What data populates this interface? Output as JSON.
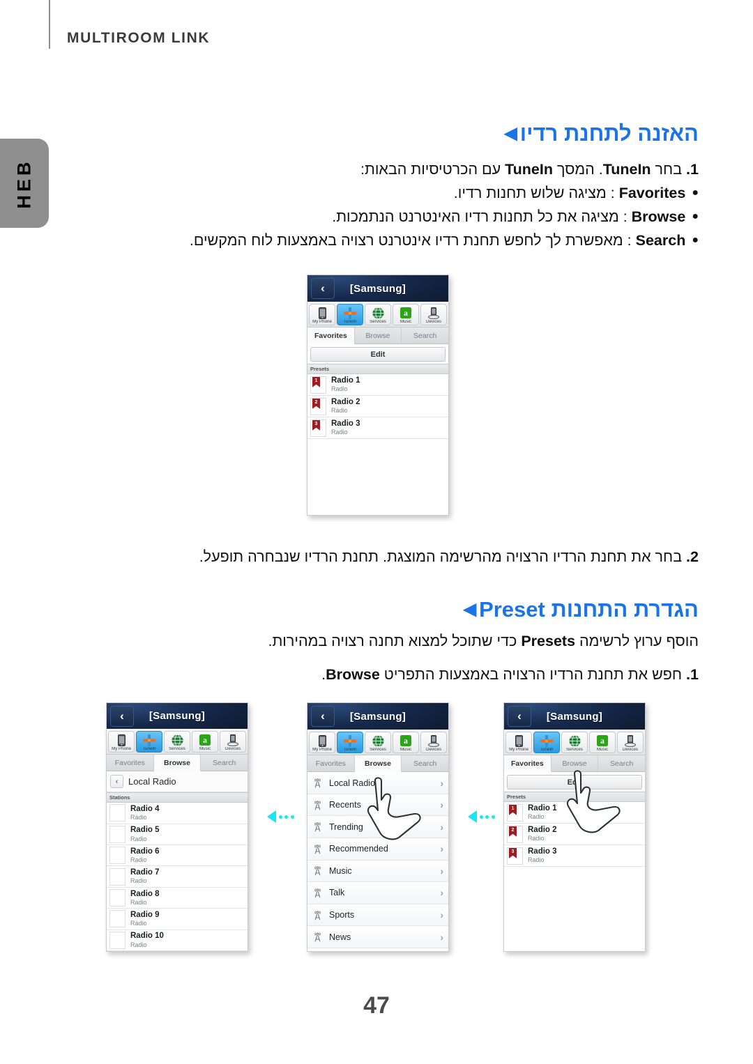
{
  "page": {
    "running_head": "MULTIROOM LINK",
    "language_tab": "HEB",
    "page_number": "47"
  },
  "sections": [
    {
      "id": "listen",
      "heading": "האזנה לתחנת רדיו",
      "marker": "◀",
      "steps": [
        {
          "number": "1.",
          "text_a": "בחר ",
          "bold_a": "TuneIn",
          "text_b": ". המסך ",
          "bold_b": "TuneIn",
          "text_c": " עם הכרטיסיות הבאות:"
        }
      ],
      "bullets": [
        {
          "marker": "●",
          "term": "Favorites",
          "text": " : מציגה שלוש תחנות רדיו."
        },
        {
          "marker": "●",
          "term": "Browse",
          "text": " : מציגה את כל תחנות רדיו האינטרנט הנתמכות."
        },
        {
          "marker": "●",
          "term": "Search",
          "text": " : מאפשרת לך לחפש תחנת רדיו אינטרנט רצויה באמצעות לוח המקשים."
        }
      ],
      "step2": {
        "number": "2.",
        "text": "בחר את תחנת הרדיו הרצויה מהרשימה המוצגת. תחנת הרדיו שנבחרה תופעל."
      }
    },
    {
      "id": "preset",
      "heading_rtl": "הגדרת התחנות ",
      "heading_ltr": "Preset",
      "marker": "◀",
      "lead_a": "הוסף ערוץ לרשימה ",
      "lead_bold": "Presets",
      "lead_b": " כדי שתוכל למצוא תחנה רצויה במהירות.",
      "step1": {
        "number": "1.",
        "text_a": "חפש את תחנת הרדיו הרצויה באמצעות התפריט ",
        "bold": "Browse",
        "text_b": "."
      }
    }
  ],
  "phone_ui": {
    "title": "[Samsung]",
    "back_glyph": "‹",
    "toolbar": [
      {
        "name": "My Phone",
        "icon": "phone-icon",
        "active": false
      },
      {
        "name": "TuneIn",
        "icon": "tunein-icon",
        "active": true
      },
      {
        "name": "Services",
        "icon": "globe-icon",
        "active": false
      },
      {
        "name": "Music",
        "icon": "amazon-music-icon",
        "active": false
      },
      {
        "name": "Devices",
        "icon": "dock-device-icon",
        "active": false
      }
    ],
    "tabs": [
      "Favorites",
      "Browse",
      "Search"
    ],
    "edit_label": "Edit",
    "presets_header": "Presets",
    "stations_header": "Stations",
    "crumb_label": "Local Radio",
    "chevron": "›",
    "sub_label": "Radio"
  },
  "screens": {
    "favorites": {
      "active_tab": "Favorites",
      "list_header": "Presets",
      "items": [
        {
          "preset": "1",
          "name": "Radio 1",
          "sub": "Radio"
        },
        {
          "preset": "2",
          "name": "Radio 2",
          "sub": "Radio"
        },
        {
          "preset": "3",
          "name": "Radio 3",
          "sub": "Radio"
        }
      ]
    },
    "local_radio": {
      "active_tab": "Browse",
      "crumb": "Local Radio",
      "list_header": "Stations",
      "items": [
        {
          "name": "Radio 4",
          "sub": "Radio"
        },
        {
          "name": "Radio 5",
          "sub": "Radio"
        },
        {
          "name": "Radio 6",
          "sub": "Radio"
        },
        {
          "name": "Radio 7",
          "sub": "Radio"
        },
        {
          "name": "Radio 8",
          "sub": "Radio"
        },
        {
          "name": "Radio 9",
          "sub": "Radio"
        },
        {
          "name": "Radio 10",
          "sub": "Radio"
        }
      ]
    },
    "browse": {
      "active_tab": "Browse",
      "items": [
        {
          "name": "Local Radio"
        },
        {
          "name": "Recents"
        },
        {
          "name": "Trending"
        },
        {
          "name": "Recommended"
        },
        {
          "name": "Music"
        },
        {
          "name": "Talk"
        },
        {
          "name": "Sports"
        },
        {
          "name": "News"
        }
      ]
    },
    "presets_tap": {
      "active_tab": "Favorites",
      "edit_label": "Edit",
      "list_header": "Presets",
      "items": [
        {
          "preset": "1",
          "name": "Radio 1",
          "sub": "Radio"
        },
        {
          "preset": "2",
          "name": "Radio 2",
          "sub": "Radio"
        },
        {
          "preset": "3",
          "name": "Radio 3",
          "sub": "Radio"
        }
      ]
    }
  },
  "colors": {
    "heading_blue": "#1a73e8",
    "flow_arrow_cyan": "#19e6f5",
    "lang_tab_gray": "#8f8f8f",
    "preset_ribbon_red": "#9e1c21"
  }
}
